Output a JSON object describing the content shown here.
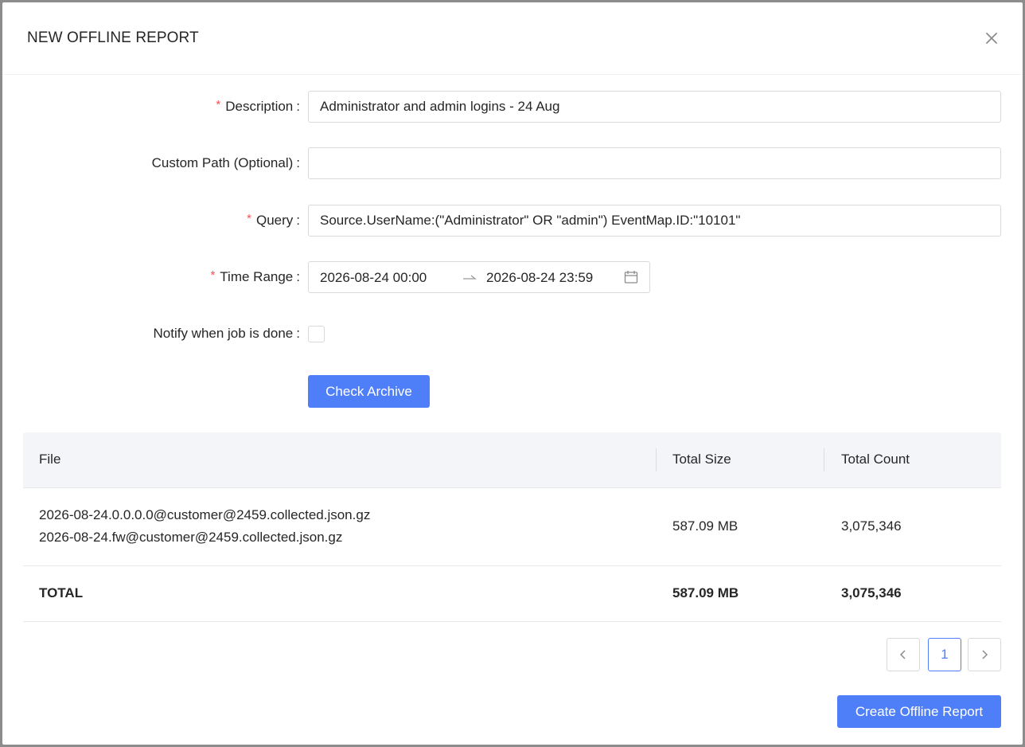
{
  "modal": {
    "title": "NEW OFFLINE REPORT",
    "close_icon": "close-icon"
  },
  "form": {
    "description": {
      "label": "Description",
      "required": true,
      "value": "Administrator and admin logins - 24 Aug"
    },
    "custom_path": {
      "label": "Custom Path (Optional)",
      "required": false,
      "value": ""
    },
    "query": {
      "label": "Query",
      "required": true,
      "value": "Source.UserName:(\"Administrator\" OR \"admin\") EventMap.ID:\"10101\""
    },
    "time_range": {
      "label": "Time Range",
      "required": true,
      "start": "2026-08-24 00:00",
      "separator": "→",
      "end": "2026-08-24 23:59",
      "icon": "calendar-icon"
    },
    "notify": {
      "label": "Notify when job is done",
      "checked": false
    },
    "colon": ":",
    "required_mark": "*",
    "check_archive_label": "Check Archive"
  },
  "table": {
    "columns": [
      "File",
      "Total Size",
      "Total Count"
    ],
    "rows": [
      {
        "files": [
          "2026-08-24.0.0.0.0@customer@2459.collected.json.gz",
          "2026-08-24.fw@customer@2459.collected.json.gz"
        ],
        "size": "587.09 MB",
        "count": "3,075,346"
      }
    ],
    "total": {
      "label": "TOTAL",
      "size": "587.09 MB",
      "count": "3,075,346"
    }
  },
  "pagination": {
    "prev_icon": "chevron-left-icon",
    "current_page": "1",
    "next_icon": "chevron-right-icon"
  },
  "footer": {
    "create_label": "Create Offline Report"
  },
  "colors": {
    "primary": "#4f7ff8",
    "required": "#ff4d4f",
    "header_bg": "#f4f5f9"
  }
}
